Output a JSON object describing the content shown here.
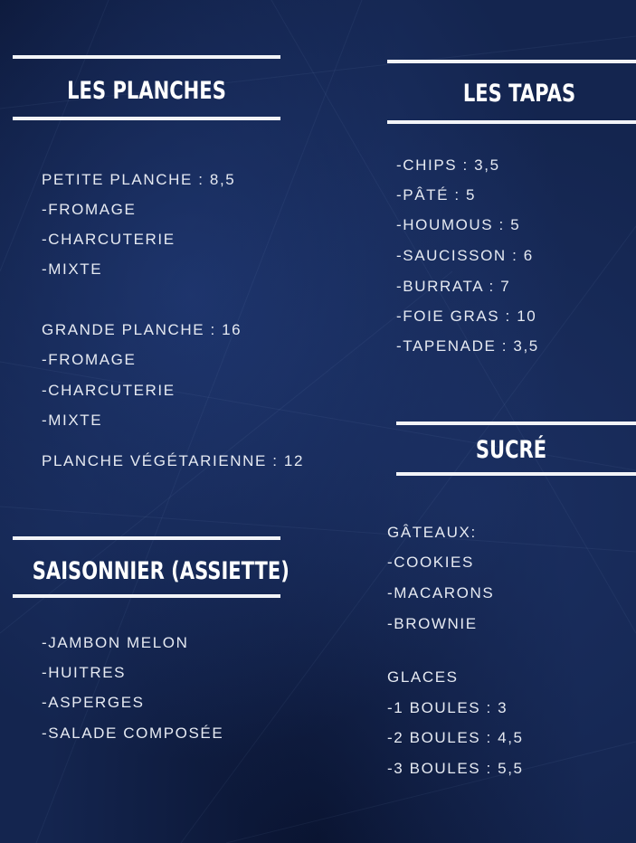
{
  "planches": {
    "title": "LES PLANCHES",
    "items": [
      "PETITE PLANCHE : 8,5",
      "-FROMAGE",
      "-CHARCUTERIE",
      "-MIXTE",
      "GRANDE PLANCHE  : 16",
      "-FROMAGE",
      "-CHARCUTERIE",
      "-MIXTE",
      "PLANCHE VÉGÉTARIENNE  : 12"
    ]
  },
  "tapas": {
    "title": "LES TAPAS",
    "items": [
      "-CHIPS : 3,5",
      "-PÂTÉ : 5",
      "-HOUMOUS : 5",
      "-SAUCISSON : 6",
      "-BURRATA : 7",
      "-FOIE GRAS : 10",
      "-TAPENADE : 3,5"
    ]
  },
  "saisonnier": {
    "title": "SAISONNIER (ASSIETTE)",
    "items": [
      "-JAMBON MELON",
      "-HUITRES",
      "-ASPERGES",
      "-SALADE COMPOSÉE"
    ]
  },
  "sucre": {
    "title": "SUCRÉ",
    "items": [
      "GÂTEAUX:",
      "-COOKIES",
      "-MACARONS",
      "-BROWNIE",
      "GLACES",
      "-1 BOULES : 3",
      "-2 BOULES : 4,5",
      "-3 BOULES : 5,5"
    ]
  }
}
